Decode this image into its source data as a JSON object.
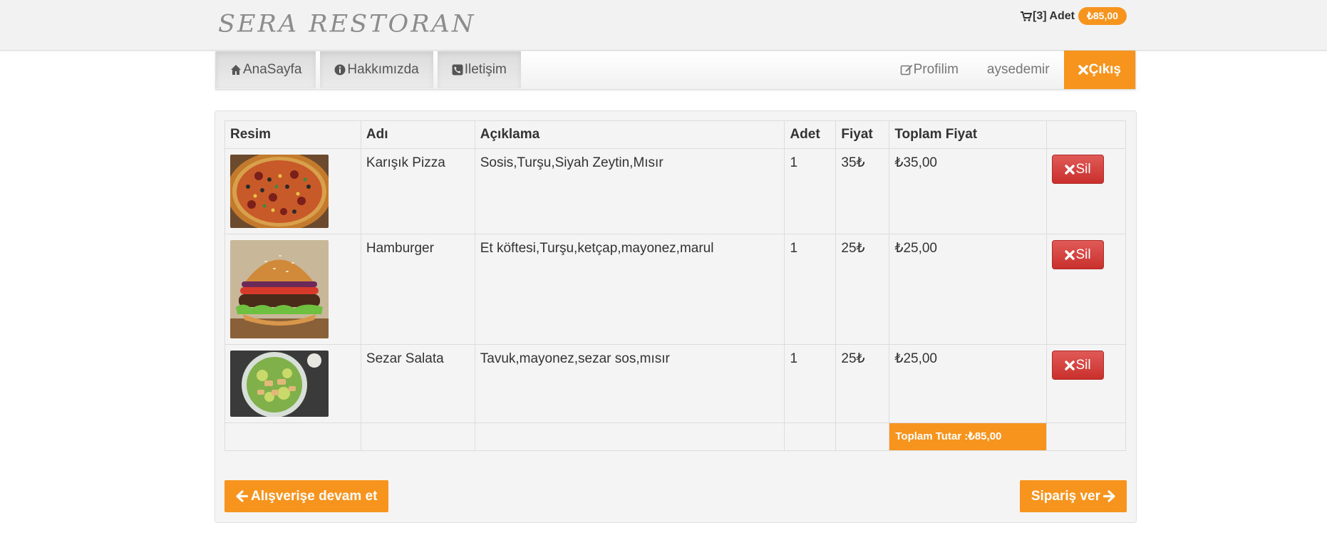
{
  "header": {
    "brand": "SERA RESTORAN",
    "cart_count_text": "[3] Adet",
    "cart_total": "₺85,00"
  },
  "nav": {
    "left": [
      {
        "label": "AnaSayfa",
        "icon": "home-icon"
      },
      {
        "label": "Hakkımızda",
        "icon": "info-icon"
      },
      {
        "label": "Iletişim",
        "icon": "phone-icon"
      }
    ],
    "profile_label": "Profilim",
    "username": "aysedemir",
    "logout_label": "Çıkış"
  },
  "cart_table": {
    "headers": [
      "Resim",
      "Adı",
      "Açıklama",
      "Adet",
      "Fiyat",
      "Toplam Fiyat",
      ""
    ],
    "rows": [
      {
        "name": "Karışık Pizza",
        "description": "Sosis,Turşu,Siyah Zeytin,Mısır",
        "qty": "1",
        "price": "35₺",
        "total": "₺35,00",
        "image": "pizza-image",
        "delete_label": "Sil"
      },
      {
        "name": "Hamburger",
        "description": "Et köftesi,Turşu,ketçap,mayonez,marul",
        "qty": "1",
        "price": "25₺",
        "total": "₺25,00",
        "image": "hamburger-image",
        "delete_label": "Sil"
      },
      {
        "name": "Sezar Salata",
        "description": "Tavuk,mayonez,sezar sos,mısır",
        "qty": "1",
        "price": "25₺",
        "total": "₺25,00",
        "image": "salad-image",
        "delete_label": "Sil"
      }
    ],
    "grand_total_label": "Toplam Tutar :₺85,00"
  },
  "actions": {
    "continue_label": "Alışverişe devam et",
    "order_label": "Sipariş ver"
  },
  "colors": {
    "accent": "#f7941d",
    "danger": "#d9534f"
  }
}
